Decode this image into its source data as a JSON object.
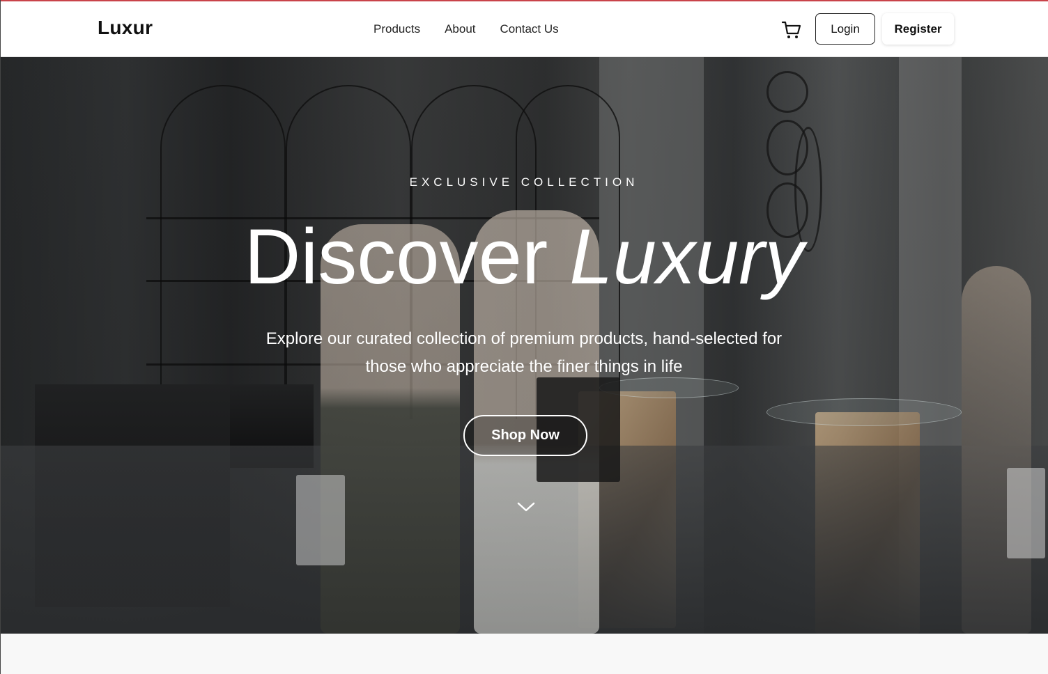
{
  "brand": {
    "name": "Luxur"
  },
  "nav": {
    "items": [
      "Products",
      "About",
      "Contact Us"
    ]
  },
  "header": {
    "cart_icon": "shopping-cart-icon",
    "login_label": "Login",
    "register_label": "Register"
  },
  "hero": {
    "eyebrow": "EXCLUSIVE COLLECTION",
    "headline_main": "Discover",
    "headline_accent": "Luxury",
    "subtitle": "Explore our curated collection of premium products, hand-selected for those who appreciate the finer things in life",
    "cta_label": "Shop Now",
    "scroll_icon": "chevron-down-icon"
  },
  "colors": {
    "accent_bar": "#c9434a",
    "hero_text": "#ffffff",
    "header_bg": "#ffffff"
  }
}
